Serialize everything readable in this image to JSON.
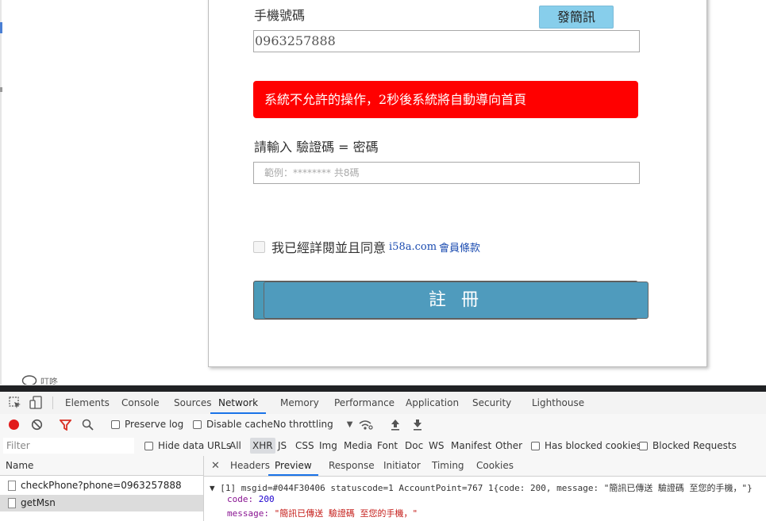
{
  "form": {
    "phone_label": "手機號碼",
    "sms_button": "發簡訊",
    "phone_value": "0963257888",
    "alert_message": "系統不允許的操作，2秒後系統將自動導向首頁",
    "code_label": "請輸入 驗證碼 = 密碼",
    "code_placeholder": "範例：******** 共8碼",
    "agree_text": "我已經詳閱並且同意",
    "agree_link_site": "i58a.com",
    "agree_link_terms": "會員條款",
    "register_button": "註 冊"
  },
  "chat": {
    "label": "叮咚"
  },
  "devtools": {
    "tabs": [
      "Elements",
      "Console",
      "Sources",
      "Network",
      "Memory",
      "Performance",
      "Application",
      "Security",
      "Lighthouse"
    ],
    "active_tab": "Network",
    "toolbar": {
      "preserve_log": "Preserve log",
      "disable_cache": "Disable cache",
      "throttling": "No throttling"
    },
    "filter": {
      "placeholder": "Filter",
      "hide_data_urls": "Hide data URLs",
      "types": [
        "All",
        "XHR",
        "JS",
        "CSS",
        "Img",
        "Media",
        "Font",
        "Doc",
        "WS",
        "Manifest",
        "Other"
      ],
      "active_type": "XHR",
      "has_blocked_cookies": "Has blocked cookies",
      "blocked_requests": "Blocked Requests"
    },
    "requests": {
      "name_header": "Name",
      "items": [
        "checkPhone?phone=0963257888",
        "getMsn"
      ]
    },
    "detail_tabs": [
      "Headers",
      "Preview",
      "Response",
      "Initiator",
      "Timing",
      "Cookies"
    ],
    "active_detail_tab": "Preview",
    "preview": {
      "line1": "▼ [1] msgid=#044F30406 statuscode=1 AccountPoint=767 1{code: 200, message: \"簡訊已傳送 驗證碼 至您的手機，\"}",
      "code_key": "code:",
      "code_value": "200",
      "message_key": "message:",
      "message_value": "\"簡訊已傳送 驗證碼 至您的手機，\""
    }
  }
}
